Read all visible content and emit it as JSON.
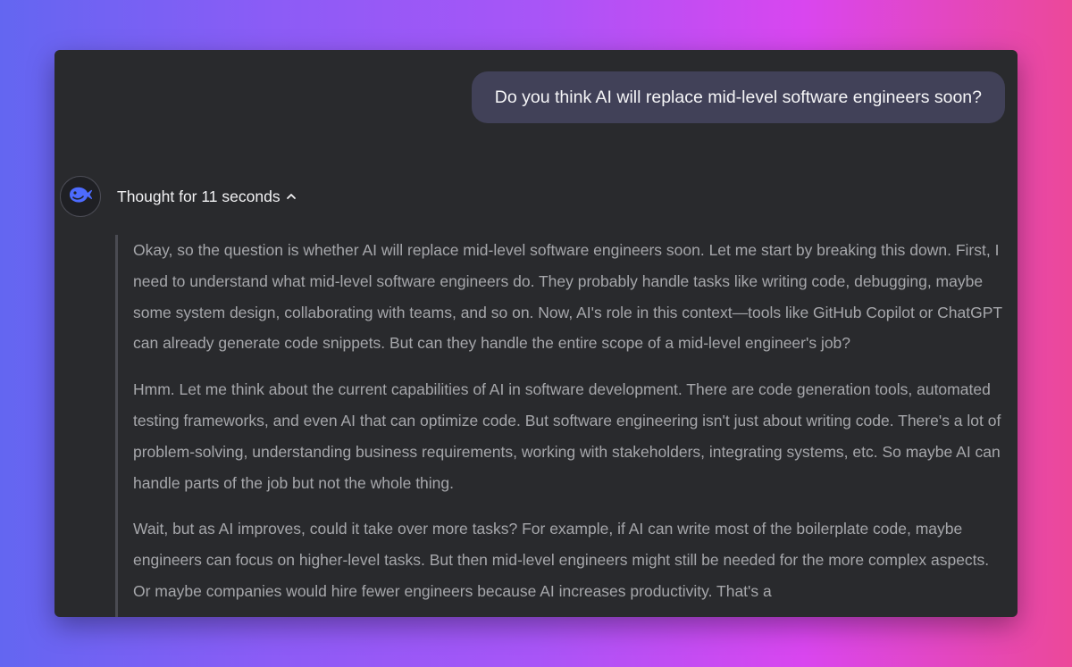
{
  "conversation": {
    "user_message": "Do you think AI will replace mid-level software engineers soon?",
    "assistant": {
      "avatar_icon": "deepseek-whale-icon",
      "thought_label": "Thought for 11 seconds",
      "thought_toggle_icon": "chevron-up-icon",
      "reasoning_paragraphs": [
        "Okay, so the question is whether AI will replace mid-level software engineers soon. Let me start by breaking this down. First, I need to understand what mid-level software engineers do. They probably handle tasks like writing code, debugging, maybe some system design, collaborating with teams, and so on. Now, AI's role in this context—tools like GitHub Copilot or ChatGPT can already generate code snippets. But can they handle the entire scope of a mid-level engineer's job?",
        "Hmm. Let me think about the current capabilities of AI in software development. There are code generation tools, automated testing frameworks, and even AI that can optimize code. But software engineering isn't just about writing code. There's a lot of problem-solving, understanding business requirements, working with stakeholders, integrating systems, etc. So maybe AI can handle parts of the job but not the whole thing.",
        "Wait, but as AI improves, could it take over more tasks? For example, if AI can write most of the boilerplate code, maybe engineers can focus on higher-level tasks. But then mid-level engineers might still be needed for the more complex aspects. Or maybe companies would hire fewer engineers because AI increases productivity. That's a"
      ]
    }
  },
  "colors": {
    "window_bg": "#292a2d",
    "user_bubble_bg": "#414158",
    "reasoning_text": "#a6a7ab",
    "accent_blue": "#4d6bfe"
  }
}
